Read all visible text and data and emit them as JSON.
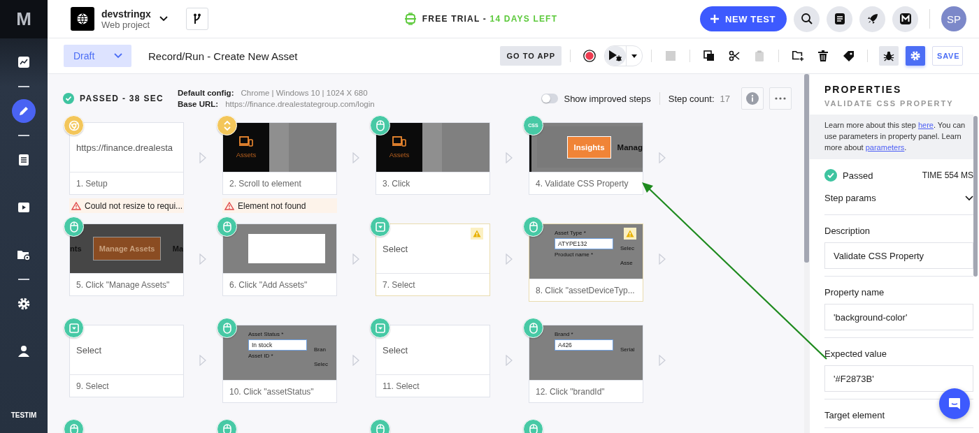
{
  "sidebar": {
    "logo": "M",
    "groups": [
      [
        {
          "kind": "chart",
          "selected": false
        }
      ],
      [
        {
          "kind": "pencil",
          "selected": true
        }
      ],
      [
        {
          "kind": "list",
          "selected": false
        },
        {
          "kind": "play",
          "selected": false
        },
        {
          "kind": "folder-gear",
          "selected": false
        }
      ],
      [
        {
          "kind": "gear",
          "selected": false
        },
        {
          "kind": "user",
          "selected": false
        }
      ]
    ],
    "brand": "TESTIM"
  },
  "topbar": {
    "project": {
      "name": "devstringx",
      "type": "Web project"
    },
    "trial": {
      "label": "FREE TRIAL - ",
      "highlight": "14 DAYS LEFT"
    },
    "new_test": "NEW TEST",
    "actions": [
      {
        "kind": "search"
      },
      {
        "kind": "document"
      },
      {
        "kind": "rocket"
      },
      {
        "kind": "logo"
      }
    ],
    "avatar": "SP"
  },
  "toolbar": {
    "status": "Draft",
    "title": "Record/Run - Create New Asset",
    "go_to_app": "GO TO APP",
    "tools": [
      {
        "kind": "record",
        "disabled": false
      },
      {
        "kind": "run",
        "disabled": false
      },
      {
        "kind": "stop",
        "disabled": true
      },
      {
        "kind": "copy",
        "disabled": false
      },
      {
        "kind": "cut",
        "disabled": false
      },
      {
        "kind": "paste",
        "disabled": true
      },
      {
        "kind": "add-folder",
        "disabled": false
      },
      {
        "kind": "delete",
        "disabled": false
      },
      {
        "kind": "tag",
        "disabled": false
      }
    ],
    "toggles": [
      {
        "kind": "debug",
        "selected": false
      },
      {
        "kind": "settings",
        "selected": true
      }
    ],
    "save": "SAVE"
  },
  "canvas": {
    "result": {
      "label": "PASSED - 38 SEC",
      "passed": true
    },
    "config": {
      "label": "Default config:",
      "value": "Chrome | Windows 10 | 1024 X 680"
    },
    "base_url": {
      "label": "Base URL:",
      "value": "https://finance.drealestategroup.com/login"
    },
    "toggle": {
      "label": "Show improved steps",
      "on": false
    },
    "step_count": {
      "label": "Step count:",
      "value": "17"
    },
    "steps": [
      {
        "kind": "chrome",
        "caption": "1. Setup",
        "thumb": {
          "kind": "text",
          "text": "https://finance.drealesta"
        },
        "warning": "Could not resize to requi...",
        "flagged": false
      },
      {
        "kind": "scroll",
        "caption": "2. Scroll to element",
        "thumb": {
          "kind": "nav",
          "text": "Assets"
        },
        "warning": "Element not found",
        "flagged": false
      },
      {
        "kind": "mouse",
        "caption": "3. Click",
        "thumb": {
          "kind": "nav",
          "text": "Assets"
        },
        "flagged": false
      },
      {
        "kind": "css",
        "icon_label": "CSS",
        "caption": "4. Validate CSS Property",
        "thumb": {
          "kind": "insights",
          "button": "Insights",
          "text": "Manag"
        },
        "flagged": false
      },
      {
        "kind": "mouse",
        "caption": "5. Click \"Manage Assets\"",
        "thumb": {
          "kind": "manage",
          "left": "nts",
          "button": "Manage Assets",
          "right": "Ma"
        },
        "flagged": false
      },
      {
        "kind": "mouse",
        "caption": "6. Click \"Add Assets\"",
        "thumb": {
          "kind": "dialog"
        },
        "flagged": false
      },
      {
        "kind": "select",
        "caption": "7. Select",
        "thumb": {
          "kind": "text",
          "text": "Select"
        },
        "flagged": true
      },
      {
        "kind": "mouse",
        "caption": "8. Click \"assetDeviceTyp...",
        "thumb": {
          "kind": "form",
          "label": "Asset Type *",
          "value": "ATYPE132",
          "below": "Product name *",
          "side": [
            "Selec",
            "Asse"
          ]
        },
        "flagged": true
      },
      {
        "kind": "select",
        "caption": "9. Select",
        "thumb": {
          "kind": "text",
          "text": "Select"
        },
        "flagged": false
      },
      {
        "kind": "mouse",
        "caption": "10. Click \"assetStatus\"",
        "thumb": {
          "kind": "form",
          "label": "Asset Status *",
          "value": "In stock",
          "below": "Asset ID *",
          "side": [
            "Bran",
            "Selec"
          ]
        },
        "flagged": false
      },
      {
        "kind": "select",
        "caption": "11. Select",
        "thumb": {
          "kind": "text",
          "text": "Select"
        },
        "flagged": false
      },
      {
        "kind": "mouse",
        "caption": "12. Click \"brandId\"",
        "thumb": {
          "kind": "form",
          "label": "Brand *",
          "value": "A426",
          "side": [
            "Serial"
          ]
        },
        "flagged": false
      }
    ],
    "partial_steps": [
      {
        "kind": "mouse"
      },
      {
        "kind": "mouse"
      },
      {
        "kind": "mouse"
      },
      {
        "kind": "mouse"
      }
    ]
  },
  "properties": {
    "title": "PROPERTIES",
    "subtitle": "VALIDATE CSS PROPERTY",
    "info": {
      "text_1": "Learn more about this step ",
      "link_1": "here",
      "text_2": ". You can use parameters in property panel. Learn more about ",
      "link_2": "parameters",
      "text_3": "."
    },
    "status": {
      "label": "Passed",
      "passed": true,
      "time": "TIME 554 MS"
    },
    "step_params": {
      "label": "Step params",
      "expanded": false
    },
    "fields": [
      {
        "label": "Description",
        "value": "Validate CSS Property"
      },
      {
        "label": "Property name",
        "value": "'background-color'"
      },
      {
        "label": "Expected value",
        "value": "'#F2873B'"
      }
    ],
    "next_label": "Target element"
  }
}
